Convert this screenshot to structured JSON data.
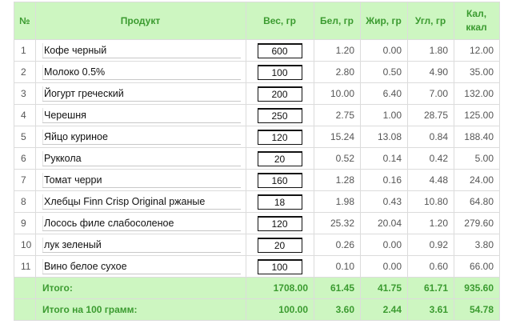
{
  "headers": {
    "num": "№",
    "product": "Продукт",
    "weight": "Вес, гр",
    "protein": "Бел, гр",
    "fat": "Жир, гр",
    "carbs": "Угл, гр",
    "kcal_line1": "Кал,",
    "kcal_line2": "ккал"
  },
  "rows": [
    {
      "n": "1",
      "name": "Кофе черный",
      "weight": "600",
      "protein": "1.20",
      "fat": "0.00",
      "carbs": "1.80",
      "kcal": "12.00"
    },
    {
      "n": "2",
      "name": "Молоко 0.5%",
      "weight": "100",
      "protein": "2.80",
      "fat": "0.50",
      "carbs": "4.90",
      "kcal": "35.00"
    },
    {
      "n": "3",
      "name": "Йогурт греческий",
      "weight": "200",
      "protein": "10.00",
      "fat": "6.40",
      "carbs": "7.00",
      "kcal": "132.00"
    },
    {
      "n": "4",
      "name": "Черешня",
      "weight": "250",
      "protein": "2.75",
      "fat": "1.00",
      "carbs": "28.75",
      "kcal": "125.00"
    },
    {
      "n": "5",
      "name": "Яйцо куриное",
      "weight": "120",
      "protein": "15.24",
      "fat": "13.08",
      "carbs": "0.84",
      "kcal": "188.40"
    },
    {
      "n": "6",
      "name": "Руккола",
      "weight": "20",
      "protein": "0.52",
      "fat": "0.14",
      "carbs": "0.42",
      "kcal": "5.00"
    },
    {
      "n": "7",
      "name": "Томат черри",
      "weight": "160",
      "protein": "1.28",
      "fat": "0.16",
      "carbs": "4.48",
      "kcal": "24.00"
    },
    {
      "n": "8",
      "name": "Хлебцы Finn Crisp Original ржаные",
      "weight": "18",
      "protein": "1.98",
      "fat": "0.43",
      "carbs": "10.80",
      "kcal": "64.80"
    },
    {
      "n": "9",
      "name": "Лосось филе слабосоленое",
      "weight": "120",
      "protein": "25.32",
      "fat": "20.04",
      "carbs": "1.20",
      "kcal": "279.60"
    },
    {
      "n": "10",
      "name": "лук зеленый",
      "weight": "20",
      "protein": "0.26",
      "fat": "0.00",
      "carbs": "0.92",
      "kcal": "3.80"
    },
    {
      "n": "11",
      "name": "Вино белое сухое",
      "weight": "100",
      "protein": "0.10",
      "fat": "0.00",
      "carbs": "0.60",
      "kcal": "66.00"
    }
  ],
  "totals": {
    "label": "Итого:",
    "weight": "1708.00",
    "protein": "61.45",
    "fat": "41.75",
    "carbs": "61.71",
    "kcal": "935.60"
  },
  "per100": {
    "label": "Итого на 100 грамм:",
    "weight": "100.00",
    "protein": "3.60",
    "fat": "2.44",
    "carbs": "3.61",
    "kcal": "54.78"
  },
  "colors": {
    "header_bg": "#cdf6c1",
    "header_text": "#3b9b30"
  }
}
